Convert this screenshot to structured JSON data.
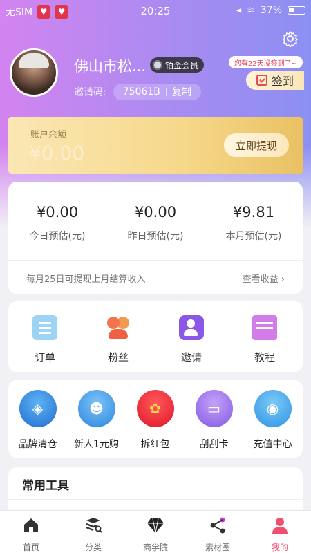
{
  "status_bar": {
    "carrier": "无SIM",
    "time": "20:25",
    "battery": "37%"
  },
  "profile": {
    "name": "佛山市松...",
    "level_badge": "铂金会员",
    "invite_label": "邀请码:",
    "invite_code": "75061B",
    "copy_label": "复制"
  },
  "signin": {
    "tip": "您有22天没签到了~",
    "label": "签到"
  },
  "balance": {
    "label": "账户余额",
    "value": "¥0.00",
    "withdraw_label": "立即提现"
  },
  "earnings": {
    "items": [
      {
        "value": "¥0.00",
        "label": "今日预估(元)"
      },
      {
        "value": "¥0.00",
        "label": "昨日预估(元)"
      },
      {
        "value": "¥9.81",
        "label": "本月预估(元)"
      }
    ],
    "note": "每月25日可提现上月结算收入",
    "link": "查看收益"
  },
  "quick_actions": [
    {
      "label": "订单",
      "icon": "order-clipboard-icon"
    },
    {
      "label": "粉丝",
      "icon": "fans-people-icon"
    },
    {
      "label": "邀请",
      "icon": "invite-user-icon"
    },
    {
      "label": "教程",
      "icon": "tutorial-folder-icon"
    }
  ],
  "promos": [
    {
      "label": "品牌清仓",
      "icon": "tag-icon",
      "color": "#2a8be4"
    },
    {
      "label": "新人1元购",
      "icon": "users-icon",
      "color": "#3d9ee8"
    },
    {
      "label": "拆红包",
      "icon": "money-bag-icon",
      "color": "#f02a3c"
    },
    {
      "label": "刮刮卡",
      "icon": "card-icon",
      "color": "#a277f0"
    },
    {
      "label": "充值中心",
      "icon": "recharge-bag-icon",
      "color": "#3aa6ee"
    }
  ],
  "tools": {
    "title": "常用工具"
  },
  "tabs": [
    {
      "label": "首页",
      "icon": "home-icon"
    },
    {
      "label": "分类",
      "icon": "category-search-icon"
    },
    {
      "label": "商学院",
      "icon": "diamond-icon"
    },
    {
      "label": "素材圈",
      "icon": "share-icon"
    },
    {
      "label": "我的",
      "icon": "user-icon",
      "active": true
    }
  ],
  "colors": {
    "accent": "#f0506e",
    "gradient_start": "#d384f0",
    "gradient_end": "#8c8ff2",
    "gold": "#f6d88a"
  }
}
